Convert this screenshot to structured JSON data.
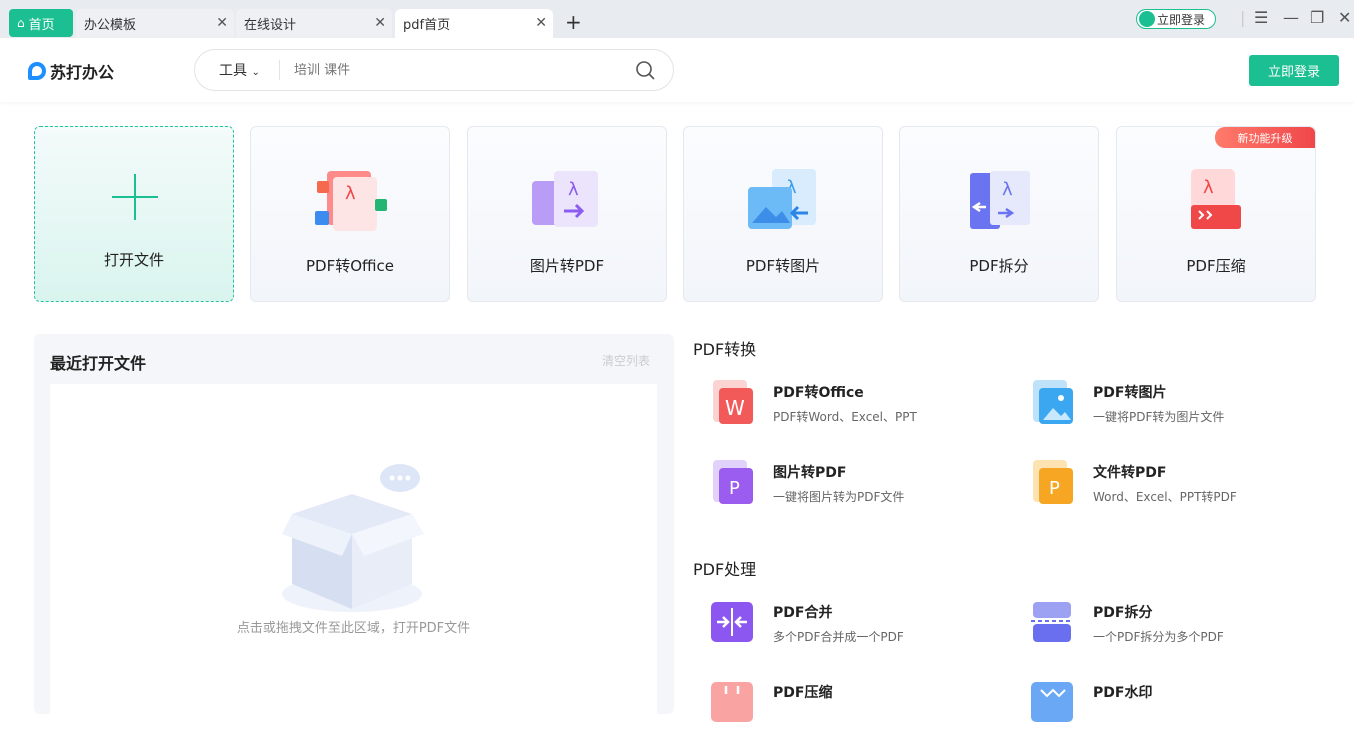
{
  "tabs": [
    {
      "label": "首页"
    },
    {
      "label": "办公模板"
    },
    {
      "label": "在线设计"
    },
    {
      "label": "pdf首页"
    }
  ],
  "top_login": "立即登录",
  "logo_text": "苏打办公",
  "search": {
    "tool_label": "工具",
    "placeholder": "培训 课件"
  },
  "login_button": "立即登录",
  "cards": [
    {
      "label": "打开文件"
    },
    {
      "label": "PDF转Office"
    },
    {
      "label": "图片转PDF"
    },
    {
      "label": "PDF转图片"
    },
    {
      "label": "PDF拆分"
    },
    {
      "label": "PDF压缩",
      "badge": "新功能升级"
    }
  ],
  "recent": {
    "title": "最近打开文件",
    "clear": "清空列表",
    "hint": "点击或拖拽文件至此区域，打开PDF文件"
  },
  "sections": [
    {
      "title": "PDF转换",
      "items": [
        {
          "title": "PDF转Office",
          "desc": "PDF转Word、Excel、PPT",
          "color": "#f25a5a"
        },
        {
          "title": "PDF转图片",
          "desc": "一键将PDF转为图片文件",
          "color": "#3aa7f0"
        },
        {
          "title": "图片转PDF",
          "desc": "一键将图片转为PDF文件",
          "color": "#9b5cf0"
        },
        {
          "title": "文件转PDF",
          "desc": "Word、Excel、PPT转PDF",
          "color": "#f6a623"
        }
      ]
    },
    {
      "title": "PDF处理",
      "items": [
        {
          "title": "PDF合并",
          "desc": "多个PDF合并成一个PDF",
          "color": "#8c57f0"
        },
        {
          "title": "PDF拆分",
          "desc": "一个PDF拆分为多个PDF",
          "color": "#6a6ff0"
        },
        {
          "title": "PDF压缩",
          "desc": "",
          "color": "#f06a6a"
        },
        {
          "title": "PDF水印",
          "desc": "",
          "color": "#3f8ff0"
        }
      ]
    }
  ]
}
